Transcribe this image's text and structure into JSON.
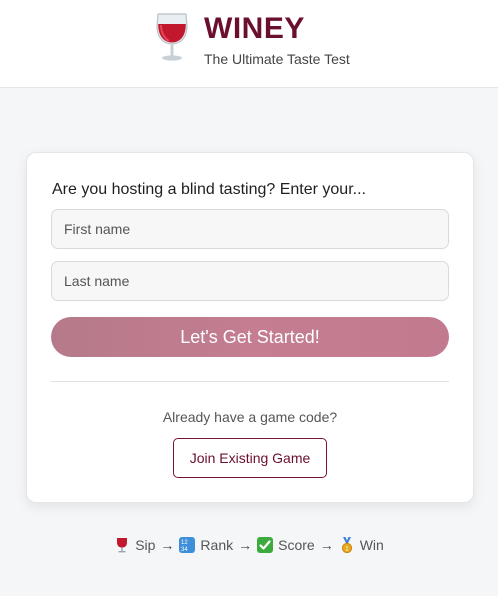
{
  "header": {
    "logo_icon": "wine-glass-icon",
    "title": "WINEY",
    "subtitle": "The Ultimate Taste Test",
    "brand_color": "#6b0f2e"
  },
  "card": {
    "prompt": "Are you hosting a blind tasting? Enter your...",
    "first_name": {
      "placeholder": "First name",
      "value": ""
    },
    "last_name": {
      "placeholder": "Last name",
      "value": ""
    },
    "start_label": "Let's Get Started!",
    "code_question": "Already have a game code?",
    "join_label": "Join Existing Game"
  },
  "steps": [
    {
      "icon": "wine-glass-icon",
      "label": "Sip"
    },
    {
      "icon": "numbers-icon",
      "label": "Rank"
    },
    {
      "icon": "check-box-icon",
      "label": "Score"
    },
    {
      "icon": "medal-icon",
      "label": "Win"
    }
  ],
  "steps_arrow": "→"
}
